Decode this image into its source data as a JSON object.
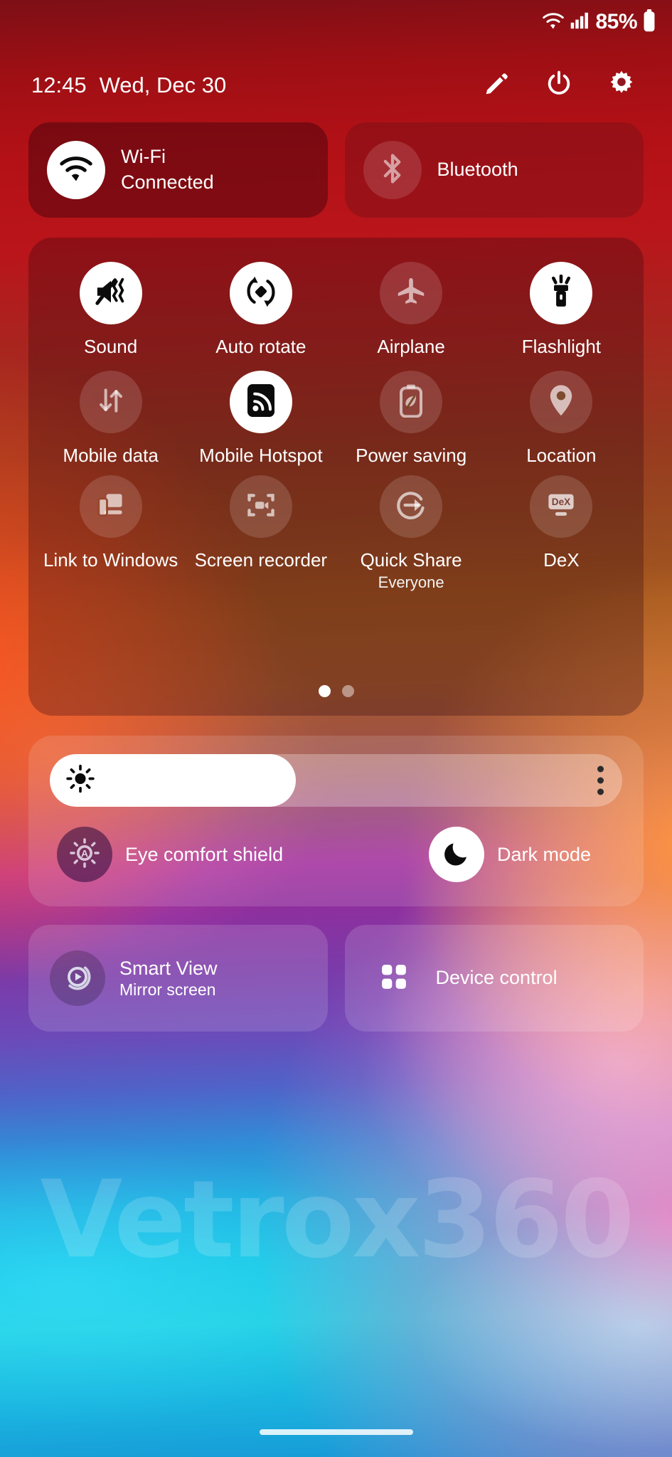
{
  "status_bar": {
    "wifi_icon": "wifi-icon",
    "signal_icon": "signal-bars-icon",
    "battery_percent": "85%",
    "battery_icon": "battery-icon"
  },
  "header": {
    "time": "12:45",
    "date": "Wed, Dec 30",
    "actions": [
      {
        "name": "edit-button",
        "icon": "pencil-icon"
      },
      {
        "name": "power-button",
        "icon": "power-icon"
      },
      {
        "name": "settings-button",
        "icon": "gear-icon"
      }
    ]
  },
  "top_tiles": [
    {
      "label": "Wi-Fi",
      "sublabel": "Connected",
      "icon": "wifi-icon",
      "state": "on"
    },
    {
      "label": "Bluetooth",
      "sublabel": "",
      "icon": "bluetooth-icon",
      "state": "off"
    }
  ],
  "quick_tiles": [
    {
      "label": "Sound",
      "sublabel": "",
      "icon": "sound-mute-vibrate-icon",
      "state": "on"
    },
    {
      "label": "Auto rotate",
      "sublabel": "",
      "icon": "auto-rotate-icon",
      "state": "on"
    },
    {
      "label": "Airplane",
      "sublabel": "",
      "icon": "airplane-icon",
      "state": "off"
    },
    {
      "label": "Flashlight",
      "sublabel": "",
      "icon": "flashlight-icon",
      "state": "on"
    },
    {
      "label": "Mobile data",
      "sublabel": "",
      "icon": "data-arrows-icon",
      "state": "off"
    },
    {
      "label": "Mobile Hotspot",
      "sublabel": "",
      "icon": "hotspot-icon",
      "state": "on"
    },
    {
      "label": "Power saving",
      "sublabel": "",
      "icon": "battery-leaf-icon",
      "state": "off"
    },
    {
      "label": "Location",
      "sublabel": "",
      "icon": "location-pin-icon",
      "state": "off"
    },
    {
      "label": "Link to Windows",
      "sublabel": "",
      "icon": "link-to-windows-icon",
      "state": "off"
    },
    {
      "label": "Screen recorder",
      "sublabel": "",
      "icon": "screen-recorder-icon",
      "state": "off"
    },
    {
      "label": "Quick Share",
      "sublabel": "Everyone",
      "icon": "quick-share-icon",
      "state": "off"
    },
    {
      "label": "DeX",
      "sublabel": "",
      "icon": "dex-icon",
      "state": "off"
    }
  ],
  "page_indicator": {
    "total": 2,
    "active": 1
  },
  "brightness": {
    "icon": "brightness-sun-icon",
    "value_percent": 43,
    "menu_icon": "overflow-menu-icon"
  },
  "display_modes": [
    {
      "label": "Eye comfort shield",
      "icon": "eye-comfort-icon",
      "state": "off"
    },
    {
      "label": "Dark mode",
      "icon": "moon-icon",
      "state": "on"
    }
  ],
  "bottom_tiles": [
    {
      "label": "Smart View",
      "sublabel": "Mirror screen",
      "icon": "smart-view-icon"
    },
    {
      "label": "Device control",
      "sublabel": "",
      "icon": "device-control-grid-icon"
    }
  ],
  "watermark": {
    "text": "Vetrox360"
  },
  "nav": {
    "pill": "home-gesture-pill"
  },
  "colors": {
    "accent_on": "#ffffff",
    "text": "#ffffff"
  }
}
